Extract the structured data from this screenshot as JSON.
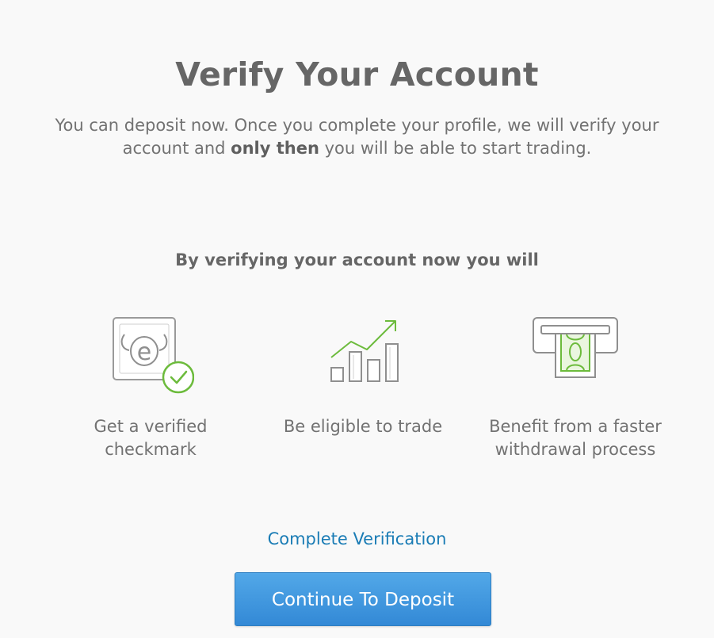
{
  "page": {
    "title": "Verify Your Account",
    "intro": {
      "part1": "You can deposit now. Once you complete your profile, we will verify your account and ",
      "bold": "only then",
      "part2": " you will be able to start trading."
    },
    "benefits_heading": "By verifying your account now you will",
    "benefits": [
      {
        "icon": "verified-user-icon",
        "label": "Get a verified checkmark"
      },
      {
        "icon": "growth-chart-icon",
        "label": "Be eligible to trade"
      },
      {
        "icon": "cash-withdrawal-icon",
        "label": "Benefit from a faster withdrawal process"
      }
    ],
    "complete_link": "Complete Verification",
    "continue_button": "Continue To Deposit"
  },
  "colors": {
    "accent_green": "#6cbb3c",
    "link_blue": "#1a7cb5",
    "button_blue": "#3f95de",
    "icon_gray": "#9a9a9a"
  }
}
